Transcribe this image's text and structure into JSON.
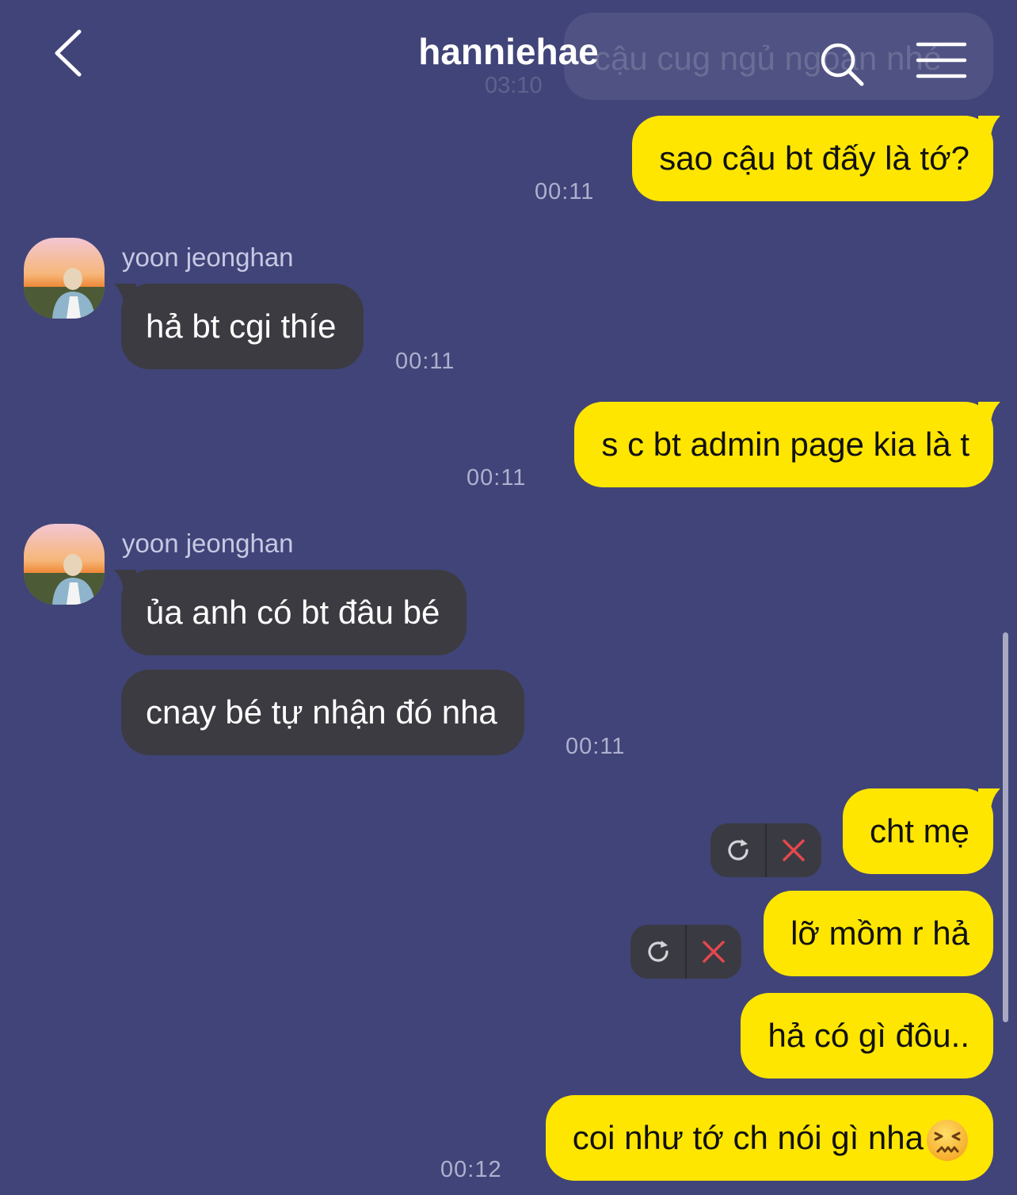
{
  "header": {
    "title": "hanniehae",
    "ghost_message": "cậu cug ngủ ngoan nhé",
    "ghost_time": "03:10"
  },
  "messages": [
    {
      "text": "sao cậu bt đấy là tớ?",
      "time": "00:11"
    },
    {
      "sender": "yoon jeonghan",
      "text": "hả bt cgi thíe",
      "time": "00:11"
    },
    {
      "text": "s c bt admin page kia là t",
      "time": "00:11"
    },
    {
      "sender": "yoon jeonghan",
      "text": "ủa anh có bt đâu bé"
    },
    {
      "text": "cnay bé tự nhận đó nha",
      "time": "00:11"
    },
    {
      "text": "cht mẹ"
    },
    {
      "text": "lỡ mồm r hả"
    },
    {
      "text": "hả có gì đôu.."
    },
    {
      "text": "coi như tớ ch nói gì nha",
      "time": "00:12",
      "emoji": "confounded-face"
    }
  ],
  "colors": {
    "background": "#414478",
    "my_bubble": "#ffe600",
    "their_bubble": "#3b3b41",
    "fail_red": "#e5484d"
  }
}
